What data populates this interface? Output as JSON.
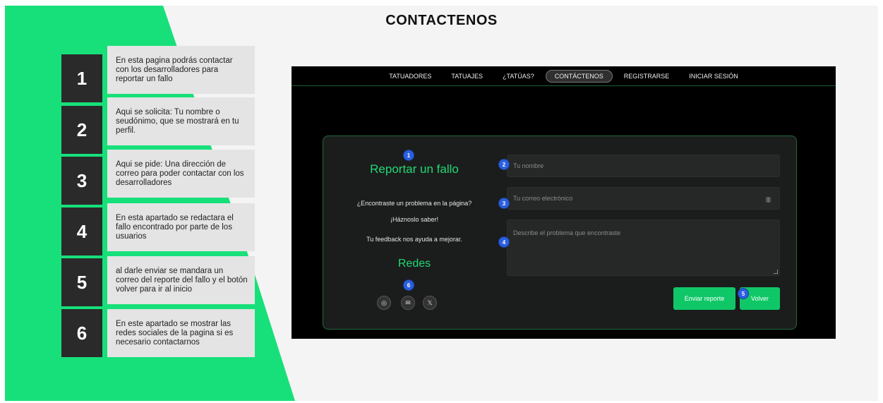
{
  "title": "CONTACTENOS",
  "steps": [
    {
      "num": "1",
      "text": "En esta pagina podrás contactar con los desarrolladores para reportar un fallo"
    },
    {
      "num": "2",
      "text": "Aqui se solicita: Tu nombre o seudónimo, que se mostrará en tu perfil."
    },
    {
      "num": "3",
      "text": "Aqui se pide: Una dirección de correo para poder contactar con los desarrolladores"
    },
    {
      "num": "4",
      "text": "En esta apartado se redactara el fallo encontrado por parte de los usuarios"
    },
    {
      "num": "5",
      "text": "al darle enviar se mandara un correo del reporte del fallo y el botón volver para ir al inicio"
    },
    {
      "num": "6",
      "text": "En este apartado se mostrar las redes sociales de la pagina si es necesario contactarnos"
    }
  ],
  "nav": {
    "items": [
      "TATUADORES",
      "TATUAJES",
      "¿TATÚAS?",
      "CONTÁCTENOS",
      "REGISTRARSE",
      "INICIAR SESIÓN"
    ],
    "active": "CONTÁCTENOS"
  },
  "form": {
    "heading": "Reportar un fallo",
    "question": "¿Encontraste un problema en la página?",
    "cta": "¡Háznoslo saber!",
    "feedback": "Tu feedback nos ayuda a mejorar.",
    "redes": "Redes",
    "name_placeholder": "Tu nombre",
    "email_placeholder": "Tu correo electrónico",
    "message_placeholder": "Describe el problema que encontraste",
    "send_label": "Enviar reporte",
    "back_label": "Volver",
    "social_icons": [
      "instagram-icon",
      "mail-icon",
      "x-icon"
    ]
  },
  "badges": [
    "1",
    "2",
    "3",
    "4",
    "5",
    "6"
  ],
  "colors": {
    "accent_green": "#17e07a",
    "app_background": "#000000",
    "card_background": "#1b1d1c",
    "badge_blue": "#2b5fe0"
  }
}
